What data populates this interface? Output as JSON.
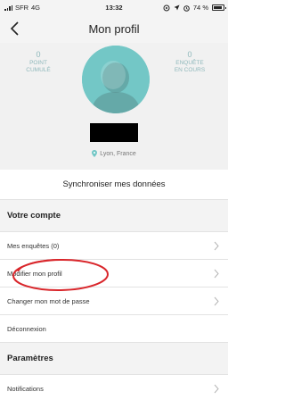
{
  "status_bar": {
    "carrier": "SFR",
    "network": "4G",
    "time": "13:32",
    "battery": "74 %"
  },
  "header": {
    "title": "Mon profil",
    "back_icon": "chevron-left-icon"
  },
  "profile": {
    "points": {
      "value": "0",
      "label_line1": "POINT",
      "label_line2": "CUMULÉ"
    },
    "surveys": {
      "value": "0",
      "label_line1": "ENQUÊTE",
      "label_line2": "EN COURS"
    },
    "avatar_icon": "user-silhouette-icon",
    "name_redacted": true,
    "location": "Lyon, France"
  },
  "sync_label": "Synchroniser mes données",
  "account_section": {
    "title": "Votre compte",
    "items": [
      {
        "label": "Mes enquêtes (0)",
        "chevron": true
      },
      {
        "label": "Modifier mon profil",
        "chevron": true
      },
      {
        "label": "Changer mon mot de passe",
        "chevron": true
      },
      {
        "label": "Déconnexion",
        "chevron": false
      }
    ]
  },
  "settings_section": {
    "title": "Paramètres",
    "items": [
      {
        "label": "Notifications",
        "chevron": true
      }
    ]
  },
  "colors": {
    "accent_teal": "#73c7c6",
    "stat_text": "#8fb8bb",
    "annotation_red": "#d9262b"
  }
}
